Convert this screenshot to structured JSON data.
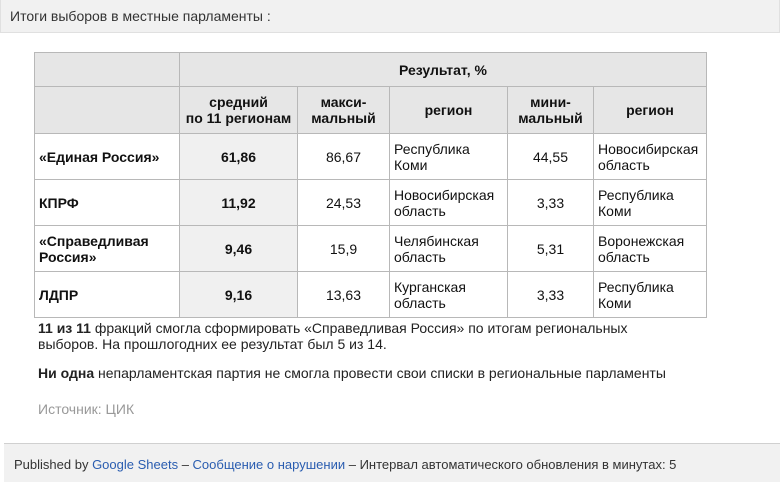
{
  "header": {
    "title": "Итоги выборов в местные парламенты :"
  },
  "table": {
    "group_header": "Результат, %",
    "columns": {
      "avg_line1": "средний",
      "avg_line2": "по 11 регионам",
      "max_line1": "макси-",
      "max_line2": "мальный",
      "region": "регион",
      "min_line1": "мини-",
      "min_line2": "мальный",
      "region2": "регион"
    },
    "rows": [
      {
        "party": "«Единая Россия»",
        "avg": "61,86",
        "max": "86,67",
        "max_region": "Республика Коми",
        "min": "44,55",
        "min_region": "Новосибирская область"
      },
      {
        "party": "КПРФ",
        "avg": "11,92",
        "max": "24,53",
        "max_region": "Новосибирская область",
        "min": "3,33",
        "min_region": "Республика Коми"
      },
      {
        "party": "«Справедливая Россия»",
        "avg": "9,46",
        "max": "15,9",
        "max_region": "Челябинская область",
        "min": "5,31",
        "min_region": "Воронежская область"
      },
      {
        "party": "ЛДПР",
        "avg": "9,16",
        "max": "13,63",
        "max_region": "Курганская область",
        "min": "3,33",
        "min_region": "Республика Коми"
      }
    ]
  },
  "notes": {
    "note1_bold": "11 из 11",
    "note1_line1": " фракций смогла сформировать «Справедливая Россия» по итогам региональных",
    "note1_line2": "выборов. На прошлогодних ее результат был 5 из 14.",
    "note2_bold": "Ни одна",
    "note2_text": " непарламентская партия не смогла провести свои списки в региональные парламенты",
    "source": "Источник: ЦИК"
  },
  "footer": {
    "published_by": "Published by ",
    "google_sheets": "Google Sheets",
    "sep1": " – ",
    "report": "Сообщение о нарушении",
    "sep2": " – ",
    "interval": "Интервал автоматического обновления в минутах: 5"
  }
}
